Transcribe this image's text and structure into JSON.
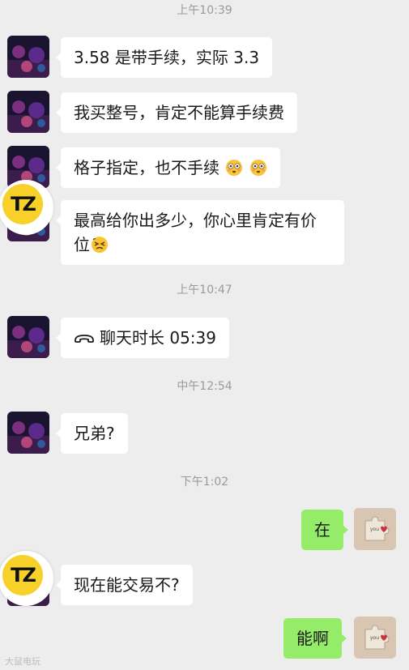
{
  "timestamps": [
    "上午10:39",
    "上午10:47",
    "中午12:54",
    "下午1:02"
  ],
  "messages": {
    "m1": "3.58 是带手续，实际 3.3",
    "m2": "我买整号，肯定不能算手续费",
    "m3": "格子指定，也不手续",
    "m4a": "最高给你出多少，你心里肯定有价",
    "m4b": "位",
    "call": "聊天时长 05:39",
    "m6": "兄弟?",
    "r1": "在",
    "m7": "现在能交易不?",
    "r2": "能啊"
  },
  "logo_text": "TZ",
  "watermark": "大鼠电玩",
  "colors": {
    "background": "#ededed",
    "incoming_bubble": "#ffffff",
    "outgoing_bubble": "#95ec69",
    "logo_yellow": "#f7d12a"
  },
  "icons": {
    "call": "phone-handset-icon",
    "emoji_flushed": "flushed-face-emoji",
    "emoji_persevering": "persevering-face-emoji"
  }
}
